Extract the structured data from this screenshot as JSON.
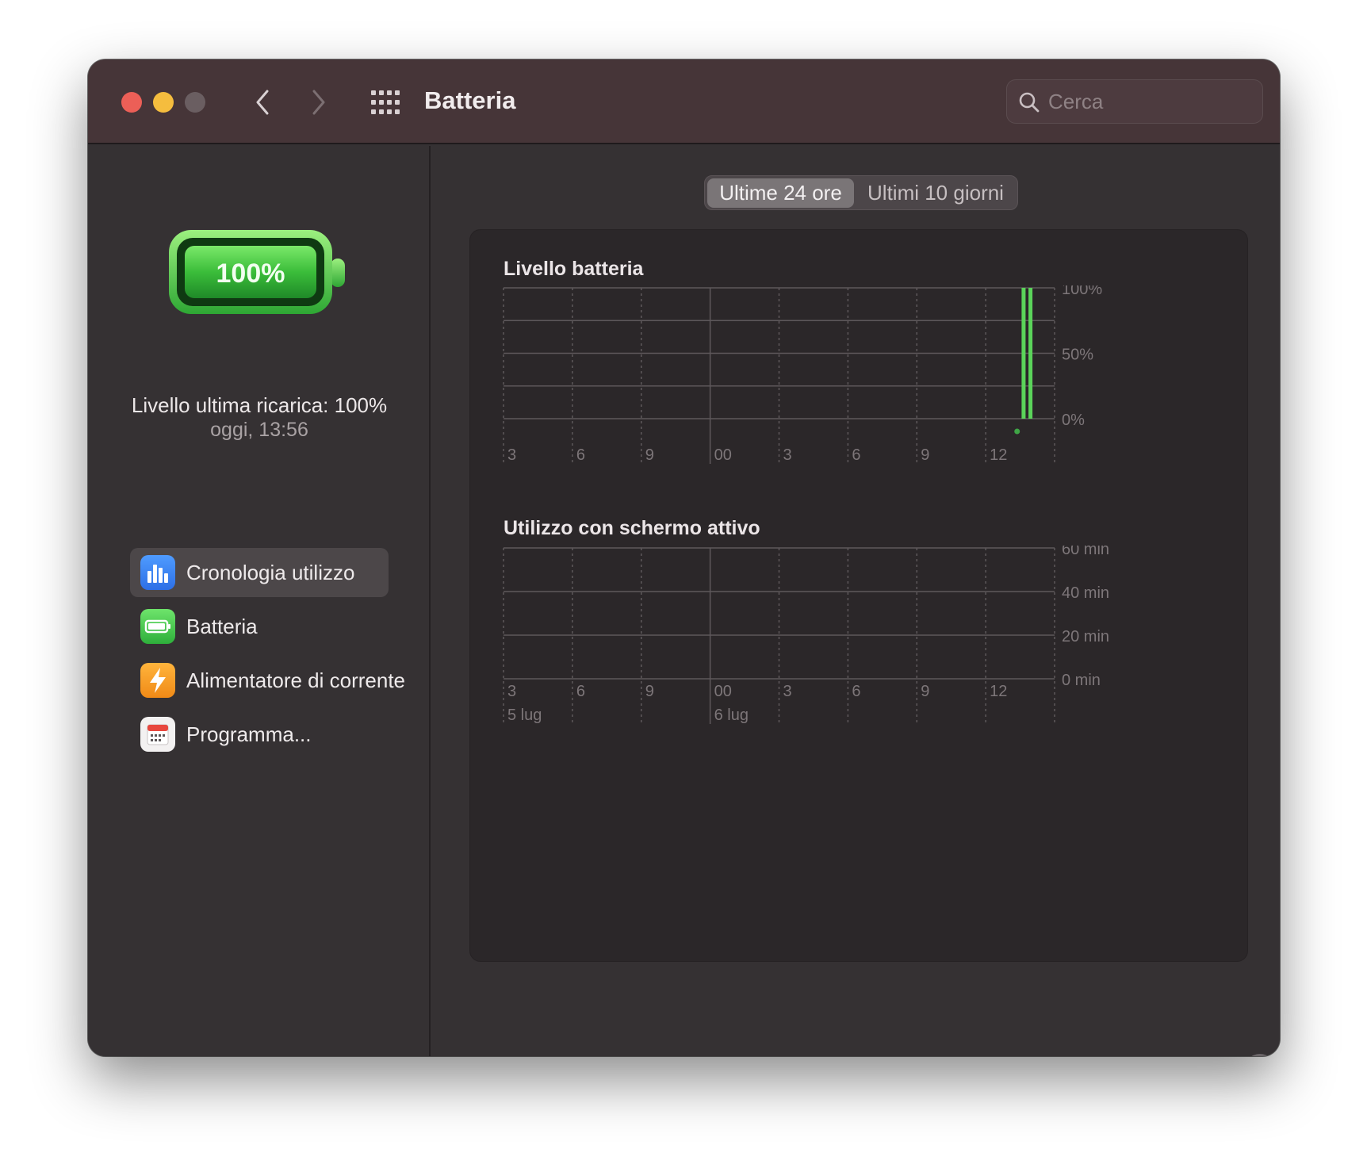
{
  "window": {
    "title": "Batteria",
    "search_placeholder": "Cerca"
  },
  "sidebar": {
    "battery_percent": "100%",
    "last_charge_label": "Livello ultima ricarica: 100%",
    "last_charge_time": "oggi, 13:56",
    "items": [
      {
        "label": "Cronologia utilizzo",
        "icon": "bar-chart-icon",
        "selected": true
      },
      {
        "label": "Batteria",
        "icon": "battery-icon",
        "selected": false
      },
      {
        "label": "Alimentatore di corrente",
        "icon": "lightning-icon",
        "selected": false
      },
      {
        "label": "Programma...",
        "icon": "calendar-icon",
        "selected": false
      }
    ]
  },
  "segmented": {
    "options": [
      "Ultime 24 ore",
      "Ultimi 10 giorni"
    ],
    "selected": 0
  },
  "colors": {
    "accent_green": "#5bd45a",
    "close": "#ec5f57",
    "minimize": "#f5bd3e"
  },
  "chart_data": [
    {
      "type": "bar",
      "title": "Livello batteria",
      "x_ticks": [
        "3",
        "6",
        "9",
        "00",
        "3",
        "6",
        "9",
        "12"
      ],
      "y_ticks": [
        "100%",
        "50%",
        "0%"
      ],
      "ylim": [
        0,
        100
      ],
      "bars": [
        {
          "hour_index": 7.55,
          "value": 100
        },
        {
          "hour_index": 7.65,
          "value": 100
        }
      ],
      "charging_dot_hour_index": 7.45
    },
    {
      "type": "bar",
      "title": "Utilizzo con schermo attivo",
      "x_ticks": [
        "3",
        "6",
        "9",
        "00",
        "3",
        "6",
        "9",
        "12"
      ],
      "date_labels": [
        "5 lug",
        "6 lug"
      ],
      "y_ticks": [
        "60 min",
        "40 min",
        "20 min",
        "0 min"
      ],
      "ylim": [
        0,
        60
      ],
      "values": []
    }
  ],
  "help_label": "?"
}
